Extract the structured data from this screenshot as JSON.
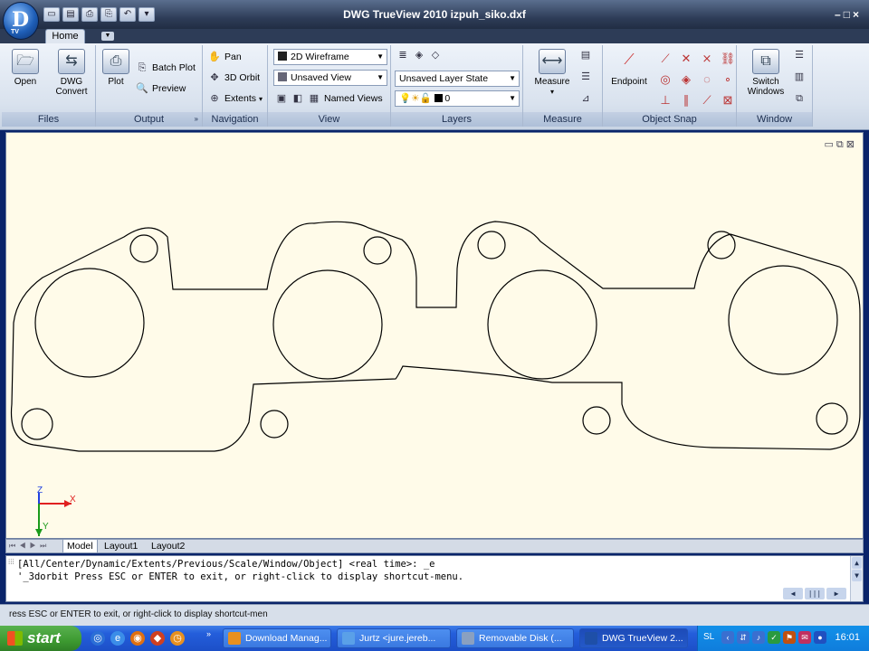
{
  "window": {
    "title": "DWG TrueView 2010    izpuh_siko.dxf",
    "app_badge": "TV",
    "controls": [
      "minimize",
      "restore",
      "close"
    ]
  },
  "ribbon_tabs": {
    "home": "Home"
  },
  "ribbon": {
    "files": {
      "label": "Files",
      "open": "Open",
      "dwg_convert": "DWG Convert"
    },
    "output": {
      "label": "Output",
      "plot": "Plot",
      "batch_plot": "Batch Plot",
      "preview": "Preview"
    },
    "navigation": {
      "label": "Navigation",
      "pan": "Pan",
      "orbit": "3D Orbit",
      "extents": "Extents"
    },
    "view": {
      "label": "View",
      "visual_style": "2D Wireframe",
      "named_view": "Unsaved View",
      "named_views": "Named Views"
    },
    "layers": {
      "label": "Layers",
      "layer_state": "Unsaved Layer State",
      "current_layer": "0"
    },
    "measure": {
      "label": "Measure",
      "measure": "Measure"
    },
    "object_snap": {
      "label": "Object Snap",
      "endpoint": "Endpoint"
    },
    "window_panel": {
      "label": "Window",
      "switch_windows": "Switch Windows"
    }
  },
  "drawing": {
    "description_visible": false,
    "ucs": {
      "x": "X",
      "y": "Y",
      "z": "Z"
    }
  },
  "layout_tabs": [
    "Model",
    "Layout1",
    "Layout2"
  ],
  "command_line": {
    "line1": "[All/Center/Dynamic/Extents/Previous/Scale/Window/Object] <real time>: _e",
    "line2": "'_3dorbit Press ESC or ENTER to exit, or right-click to display shortcut-menu."
  },
  "status_bar": {
    "text": "ress ESC or ENTER to exit, or right-click to display shortcut-men"
  },
  "taskbar": {
    "start": "start",
    "tasks": [
      "Download Manag...",
      "Jurtz <jure.jereb...",
      "Removable Disk (...",
      "DWG TrueView 2..."
    ],
    "language": "SL",
    "clock": "16:01"
  },
  "colors": {
    "title_bar": "#2d3c57",
    "drawing_bg": "#fffbe9",
    "taskbar": "#245edb",
    "start": "#3d9a31"
  }
}
